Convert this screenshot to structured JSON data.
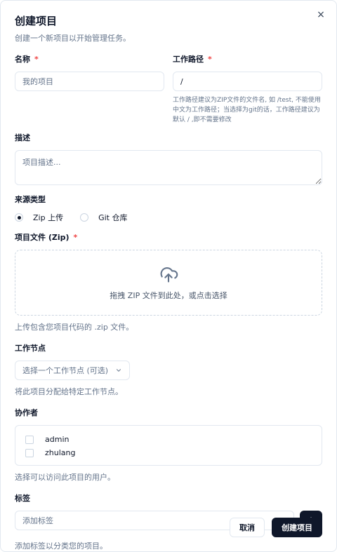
{
  "dialog": {
    "title": "创建项目",
    "subtitle": "创建一个新项目以开始管理任务。",
    "close_icon": "×"
  },
  "name_field": {
    "label": "名称",
    "required_mark": "*",
    "placeholder": "我的项目",
    "value": ""
  },
  "path_field": {
    "label": "工作路径",
    "required_mark": "*",
    "value": "/",
    "hint": "工作路径建议为ZIP文件的文件名, 如 /test, 不能使用中文为工作路径；当选择为git的话，工作路径建议为默认 / ,即不需要修改"
  },
  "description": {
    "label": "描述",
    "placeholder": "项目描述..."
  },
  "source_type": {
    "label": "来源类型",
    "options": [
      {
        "label": "Zip 上传",
        "checked": true
      },
      {
        "label": "Git 仓库",
        "checked": false
      }
    ]
  },
  "project_file": {
    "label": "项目文件 (Zip)",
    "required_mark": "*",
    "icon": "cloud-upload-icon",
    "dropzone_text": "拖拽 ZIP 文件到此处，或点击选择",
    "helper": "上传包含您项目代码的 .zip 文件。"
  },
  "work_node": {
    "label": "工作节点",
    "placeholder": "选择一个工作节点 (可选)",
    "helper": "将此项目分配给特定工作节点。"
  },
  "collaborators": {
    "label": "协作者",
    "users": [
      {
        "name": "admin",
        "checked": false
      },
      {
        "name": "zhulang",
        "checked": false
      }
    ],
    "helper": "选择可以访问此项目的用户。"
  },
  "tags": {
    "label": "标签",
    "placeholder": "添加标签",
    "add_icon": "plus-icon",
    "helper": "添加标签以分类您的项目。"
  },
  "footer": {
    "cancel_label": "取消",
    "create_label": "创建项目"
  },
  "colors": {
    "primary": "#0f172a",
    "required": "#ef4444",
    "muted": "#64748b",
    "border": "#e2e8f0"
  }
}
